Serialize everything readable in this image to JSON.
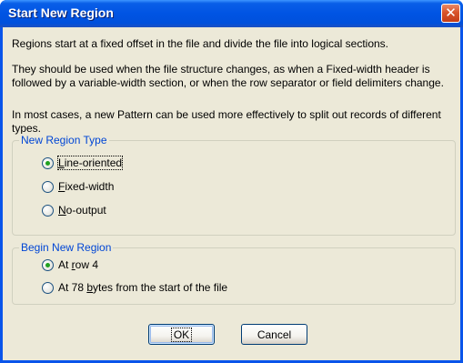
{
  "dialog": {
    "title": "Start New Region",
    "close_glyph": "✕",
    "paragraphs": [
      "Regions start at a fixed offset in the file and divide the file into logical sections.",
      "They should be used when the file structure changes, as when a Fixed-width header is followed by a variable-width section, or when the row separator or field delimiters change.",
      "In most cases, a new Pattern can be used more effectively to split out records of different types."
    ]
  },
  "region_type": {
    "legend": "New Region Type",
    "options": [
      {
        "mnemonic": "L",
        "rest": "ine-oriented",
        "checked": true
      },
      {
        "mnemonic": "F",
        "rest": "ixed-width",
        "checked": false
      },
      {
        "mnemonic": "N",
        "rest": "o-output",
        "checked": false
      }
    ]
  },
  "begin_region": {
    "legend": "Begin New Region",
    "options": [
      {
        "before": "At ",
        "mnemonic": "r",
        "after": "ow 4",
        "checked": true
      },
      {
        "before": "At 78 ",
        "mnemonic": "b",
        "after": "ytes from the start of the file",
        "checked": false
      }
    ]
  },
  "buttons": {
    "ok": "OK",
    "cancel": "Cancel"
  },
  "icons": {
    "close": "close-icon",
    "radio": "radio-button"
  }
}
